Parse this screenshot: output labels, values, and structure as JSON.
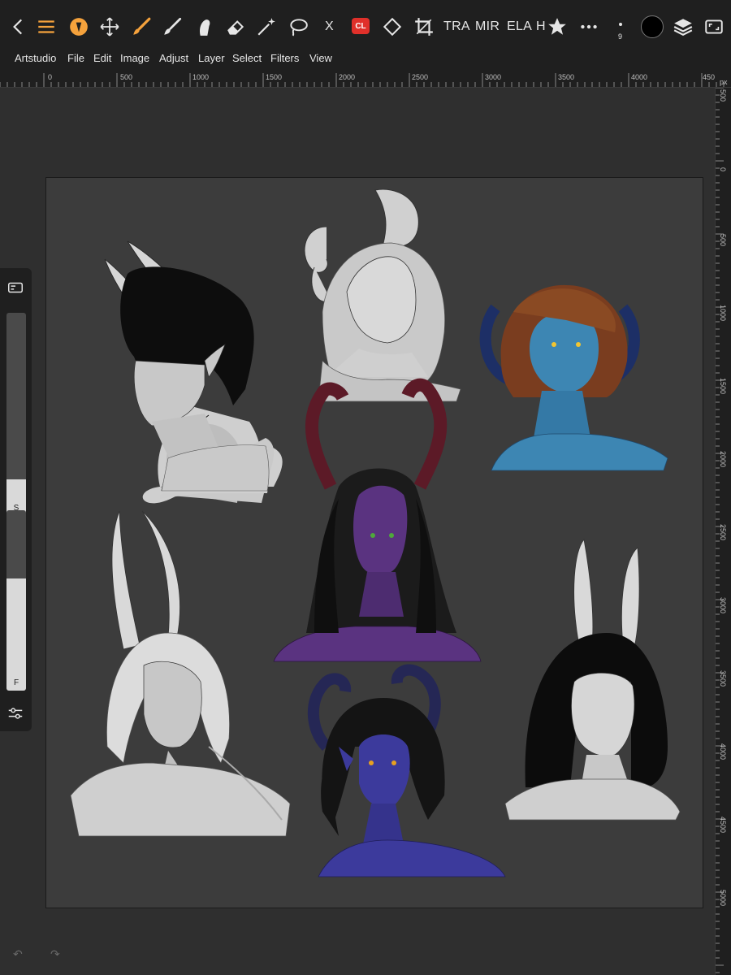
{
  "app": {
    "name": "Artstudio"
  },
  "toolbar": {
    "text_tools": [
      "TRA",
      "MIR",
      "ELA",
      "H"
    ],
    "close_label": "X",
    "cl_badge": "CL",
    "brush_size": "9",
    "current_color": "#000000",
    "accent_color": "#f5a23c"
  },
  "menu": {
    "items": [
      "Artstudio",
      "File",
      "Edit",
      "Image",
      "Adjust",
      "Layer",
      "Select",
      "Filters",
      "View"
    ]
  },
  "ruler_top": {
    "labels": [
      "0",
      "500",
      "1000",
      "1500",
      "2000",
      "2500",
      "3000",
      "3500",
      "4000",
      "450"
    ],
    "unit": "px"
  },
  "ruler_right": {
    "labels": [
      "500",
      "0",
      "500",
      "1000",
      "1500",
      "2000",
      "2500",
      "3000",
      "3500",
      "4000",
      "4500",
      "5000"
    ]
  },
  "side_panel": {
    "size_slider": {
      "label": "S",
      "value": 0.18
    },
    "flow_slider": {
      "label": "F",
      "value": 0.62
    }
  },
  "canvas": {
    "background": "#3c3c3c",
    "artwork": [
      "sketch-horned-dark-hair",
      "sketch-ram-horns-woman",
      "blue-demon-woman",
      "purple-demon-long-hair",
      "sketch-long-horns-hair-over-eye",
      "indigo-demon-curly-hair",
      "sketch-long-horns-black-hair"
    ]
  },
  "history": {
    "undo": "↶",
    "redo": "↷"
  }
}
